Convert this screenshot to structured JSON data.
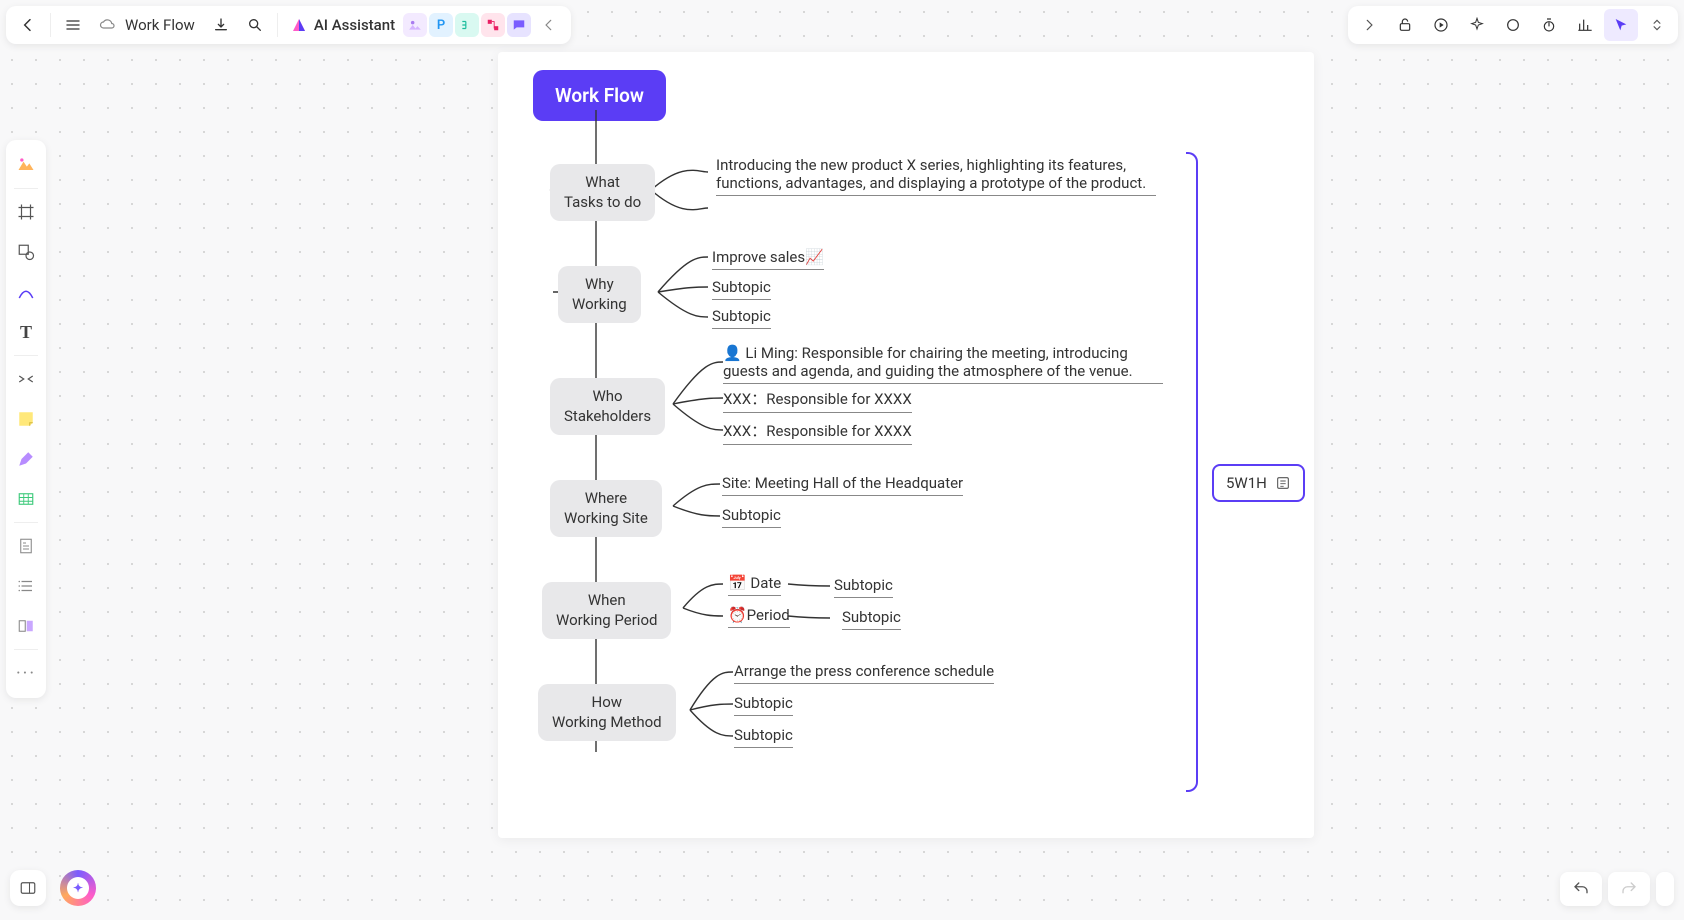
{
  "header": {
    "title": "Work Flow",
    "ai_label": "AI Assistant"
  },
  "chips": {
    "p": "P"
  },
  "mindmap": {
    "root": "Work Flow",
    "summary_label": "5W1H",
    "nodes": {
      "what": {
        "line1": "What",
        "line2": "Tasks to do",
        "items": [
          "Introducing the new product X series, highlighting its features, functions, advantages, and displaying a prototype of the product."
        ]
      },
      "why": {
        "line1": "Why",
        "line2": "Working",
        "items": [
          "Improve sales📈",
          "Subtopic",
          "Subtopic"
        ]
      },
      "who": {
        "line1": "Who",
        "line2": "Stakeholders",
        "items": [
          "👤 Li Ming: Responsible for chairing the meeting, introducing guests and agenda, and guiding the atmosphere of the venue.",
          "XXX：Responsible for XXXX",
          "XXX：Responsible for XXXX"
        ]
      },
      "where": {
        "line1": "Where",
        "line2": "Working Site",
        "items": [
          "Site: Meeting Hall of the Headquater",
          "Subtopic"
        ]
      },
      "when": {
        "line1": "When",
        "line2": "Working Period",
        "items": [
          "📅 Date",
          "⏰Period"
        ],
        "sub": [
          "Subtopic",
          "Subtopic"
        ]
      },
      "how": {
        "line1": "How",
        "line2": "Working Method",
        "items": [
          "Arrange the press conference schedule",
          "Subtopic",
          "Subtopic"
        ]
      }
    }
  }
}
